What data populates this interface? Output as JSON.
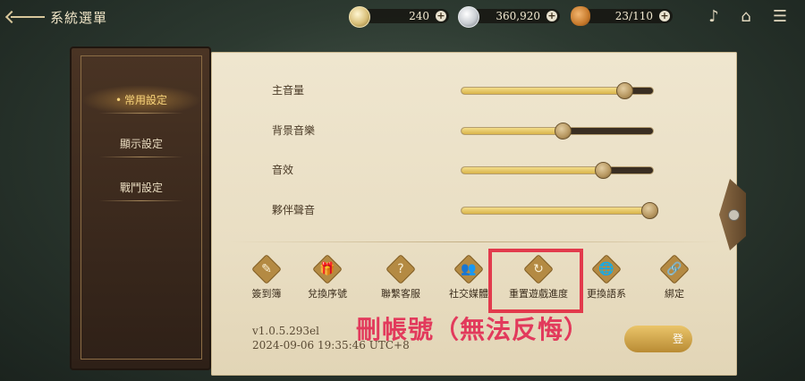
{
  "header": {
    "title": "系統選單"
  },
  "resources": [
    {
      "name": "gold-coin",
      "value": "240"
    },
    {
      "name": "silver-coin",
      "value": "360,920"
    },
    {
      "name": "bread",
      "value": "23/110"
    }
  ],
  "top_icons": [
    "gramophone-icon",
    "home-icon",
    "menu-icon"
  ],
  "sidebar": {
    "items": [
      {
        "label": "常用設定",
        "active": true
      },
      {
        "label": "顯示設定",
        "active": false
      },
      {
        "label": "戰鬥設定",
        "active": false
      }
    ]
  },
  "settings": {
    "sliders": [
      {
        "label": "主音量",
        "level": 0.85
      },
      {
        "label": "背景音樂",
        "level": 0.53
      },
      {
        "label": "音效",
        "level": 0.74
      },
      {
        "label": "夥伴聲音",
        "level": 0.98
      }
    ]
  },
  "buttons": [
    {
      "label": "簽到簿",
      "icon": "feather-icon",
      "glyph": "✎"
    },
    {
      "label": "兌換序號",
      "icon": "gift-icon",
      "glyph": "🎁"
    },
    {
      "label": "聯繫客服",
      "icon": "help-chat-icon",
      "glyph": "?"
    },
    {
      "label": "社交媒體",
      "icon": "people-icon",
      "glyph": "👥"
    },
    {
      "label": "重置遊戲進度",
      "icon": "reset-icon",
      "glyph": "↻"
    },
    {
      "label": "更換語系",
      "icon": "globe-icon",
      "glyph": "🌐"
    },
    {
      "label": "綁定",
      "icon": "link-icon",
      "glyph": "🔗"
    }
  ],
  "version": {
    "line1": "v1.0.5.293el",
    "line2": "2024-09-06 19:35:46 UTC+8"
  },
  "confirm_label": "登",
  "annotation": "刪帳號（無法反悔）",
  "colors": {
    "highlight": "#e23a4c",
    "accent_gold": "#d9b44a"
  }
}
